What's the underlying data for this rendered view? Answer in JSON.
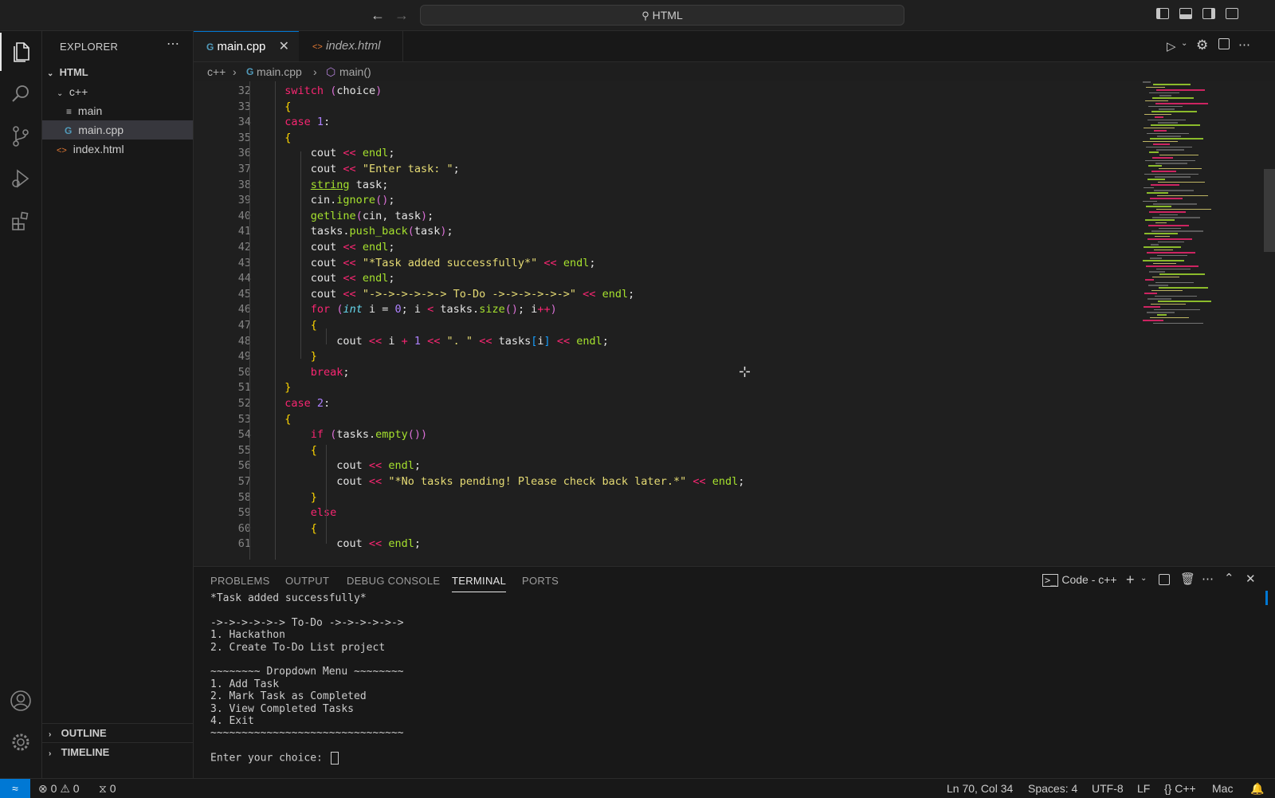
{
  "title_bar": {
    "search_label": "HTML",
    "back_icon": "arrow-left-icon",
    "forward_icon": "arrow-right-icon"
  },
  "activity_bar": [
    "explorer-icon",
    "search-icon",
    "source-control-icon",
    "run-debug-icon",
    "extensions-icon",
    "account-icon",
    "settings-gear-icon"
  ],
  "explorer": {
    "header": "EXPLORER",
    "root": "HTML",
    "items": [
      {
        "label": "c++",
        "type": "folder"
      },
      {
        "label": "main",
        "type": "file"
      },
      {
        "label": "main.cpp",
        "type": "file",
        "selected": true
      },
      {
        "label": "index.html",
        "type": "file"
      }
    ],
    "outline": "OUTLINE",
    "timeline": "TIMELINE"
  },
  "tabs": [
    {
      "label": "main.cpp",
      "active": true
    },
    {
      "label": "index.html",
      "active": false
    }
  ],
  "breadcrumb": [
    "c++",
    "main.cpp",
    "main()"
  ],
  "code": [
    {
      "n": "32",
      "t": "        switch (choice)"
    },
    {
      "n": "33",
      "t": "        {"
    },
    {
      "n": "34",
      "t": "        case 1:"
    },
    {
      "n": "35",
      "t": "        {"
    },
    {
      "n": "36",
      "t": "            cout << endl;"
    },
    {
      "n": "37",
      "t": "            cout << \"Enter task: \";"
    },
    {
      "n": "38",
      "t": "            string task;"
    },
    {
      "n": "39",
      "t": "            cin.ignore();"
    },
    {
      "n": "40",
      "t": "            getline(cin, task);"
    },
    {
      "n": "41",
      "t": "            tasks.push_back(task);"
    },
    {
      "n": "42",
      "t": "            cout << endl;"
    },
    {
      "n": "43",
      "t": "            cout << \"*Task added successfully*\" << endl;"
    },
    {
      "n": "44",
      "t": "            cout << endl;"
    },
    {
      "n": "45",
      "t": "            cout << \"->->->->->-> To-Do ->->->->->->\" << endl;"
    },
    {
      "n": "46",
      "t": "            for (int i = 0; i < tasks.size(); i++)"
    },
    {
      "n": "47",
      "t": "            {"
    },
    {
      "n": "48",
      "t": "                cout << i + 1 << \". \" << tasks[i] << endl;"
    },
    {
      "n": "49",
      "t": "            }"
    },
    {
      "n": "50",
      "t": "            break;"
    },
    {
      "n": "51",
      "t": "        }"
    },
    {
      "n": "52",
      "t": "        case 2:"
    },
    {
      "n": "53",
      "t": "        {"
    },
    {
      "n": "54",
      "t": "            if (tasks.empty())"
    },
    {
      "n": "55",
      "t": "            {"
    },
    {
      "n": "56",
      "t": "                cout << endl;"
    },
    {
      "n": "57",
      "t": "                cout << \"*No tasks pending! Please check back later.*\" << endl;"
    },
    {
      "n": "58",
      "t": "            }"
    },
    {
      "n": "59",
      "t": "            else"
    },
    {
      "n": "60",
      "t": "            {"
    },
    {
      "n": "61",
      "t": "                cout << endl;"
    }
  ],
  "panel": {
    "tabs": [
      {
        "label": "PROBLEMS",
        "active": false
      },
      {
        "label": "OUTPUT",
        "active": false
      },
      {
        "label": "DEBUG CONSOLE",
        "active": false
      },
      {
        "label": "TERMINAL",
        "active": true
      },
      {
        "label": "PORTS",
        "active": false
      }
    ],
    "terminal_name": "Code - c++",
    "terminal_lines": [
      "*Task added successfully*",
      "",
      "->->->->->-> To-Do ->->->->->->",
      "1. Hackathon",
      "2. Create To-Do List project",
      "",
      "~~~~~~~~ Dropdown Menu ~~~~~~~~",
      "1. Add Task",
      "2. Mark Task as Completed",
      "3. View Completed Tasks",
      "4. Exit",
      "~~~~~~~~~~~~~~~~~~~~~~~~~~~~~~~",
      "",
      "Enter your choice: "
    ]
  },
  "status_bar": {
    "errors": "0",
    "warnings": "0",
    "ports": "0",
    "position": "Ln 70, Col 34",
    "spaces": "Spaces: 4",
    "encoding": "UTF-8",
    "eol": "LF",
    "language": "C++",
    "platform": "Mac"
  },
  "colors": {
    "accent": "#0078d4",
    "keyword": "#f92672",
    "string": "#e6db74",
    "number": "#ae81ff",
    "function": "#a6e22e",
    "type": "#66d9ef"
  }
}
